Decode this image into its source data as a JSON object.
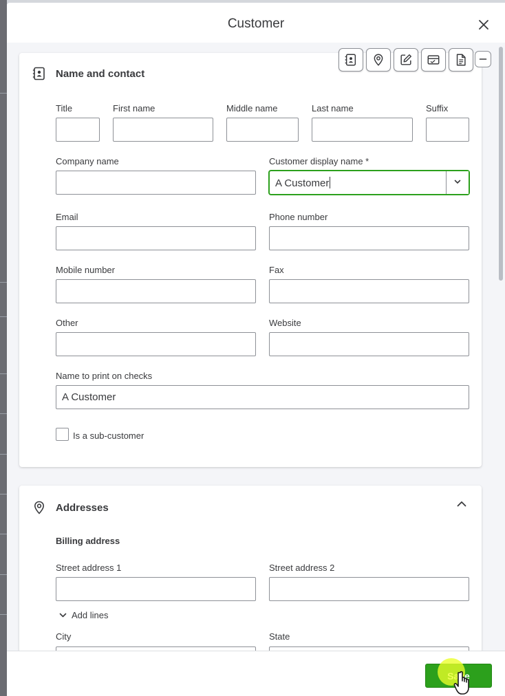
{
  "dialog": {
    "title": "Customer",
    "close_icon": "close-icon"
  },
  "toolbar": {
    "buttons": [
      "contact-card-icon",
      "location-pin-icon",
      "edit-note-icon",
      "payment-card-icon",
      "document-icon"
    ],
    "minimize_icon": "minimize-icon"
  },
  "name_contact": {
    "title": "Name and contact",
    "icon": "contact-card-icon",
    "title_label": "Title",
    "first_name_label": "First name",
    "middle_name_label": "Middle name",
    "last_name_label": "Last name",
    "suffix_label": "Suffix",
    "company_name_label": "Company name",
    "display_name_label": "Customer display name *",
    "display_name_value": "A Customer",
    "email_label": "Email",
    "phone_label": "Phone number",
    "mobile_label": "Mobile number",
    "fax_label": "Fax",
    "other_label": "Other",
    "website_label": "Website",
    "print_name_label": "Name to print on checks",
    "print_name_value": "A Customer",
    "sub_customer_label": "Is a sub-customer",
    "sub_customer_checked": false
  },
  "addresses": {
    "title": "Addresses",
    "icon": "location-pin-icon",
    "collapse_icon": "chevron-up-icon",
    "billing_heading": "Billing address",
    "street1_label": "Street address 1",
    "street2_label": "Street address 2",
    "add_lines_label": "Add lines",
    "city_label": "City",
    "state_label": "State"
  },
  "footer": {
    "save_label": "Save"
  },
  "colors": {
    "brand_green": "#2ca01c",
    "text": "#393a3d",
    "border": "#8d9096",
    "panel_bg": "#f4f5f8"
  }
}
